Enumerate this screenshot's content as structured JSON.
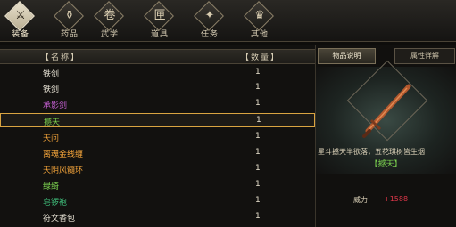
{
  "tabs": [
    {
      "label": "装备",
      "glyph": "⚔"
    },
    {
      "label": "药品",
      "glyph": "⚱"
    },
    {
      "label": "武学",
      "glyph": "卷"
    },
    {
      "label": "道具",
      "glyph": "匣"
    },
    {
      "label": "任务",
      "glyph": "✦"
    },
    {
      "label": "其他",
      "glyph": "♛"
    }
  ],
  "list": {
    "header_name": "【名称】",
    "header_qty": "【数量】",
    "items": [
      {
        "name": "铁剑",
        "qty": "1",
        "color": "white"
      },
      {
        "name": "铁剑",
        "qty": "1",
        "color": "white"
      },
      {
        "name": "承影剑",
        "qty": "1",
        "color": "purple"
      },
      {
        "name": "撼天",
        "qty": "1",
        "color": "green"
      },
      {
        "name": "天问",
        "qty": "1",
        "color": "orange"
      },
      {
        "name": "离魂金线缠",
        "qty": "1",
        "color": "orange"
      },
      {
        "name": "天阴风髓环",
        "qty": "1",
        "color": "orange"
      },
      {
        "name": "绿绮",
        "qty": "1",
        "color": "green"
      },
      {
        "name": "皂锣袍",
        "qty": "1",
        "color": "teal"
      },
      {
        "name": "符文香包",
        "qty": "1",
        "color": "white"
      }
    ],
    "selected_index": 3
  },
  "detail": {
    "tab_desc": "物品说明",
    "tab_attr": "属性详解",
    "item_name": "【撼天】",
    "description": "星斗撼天半欲落，五花琪树皆生烟",
    "power_label": "威力",
    "power_value": "+1588"
  },
  "colors": {
    "selected_border": "#d9a441",
    "power_value": "#e0374a"
  }
}
